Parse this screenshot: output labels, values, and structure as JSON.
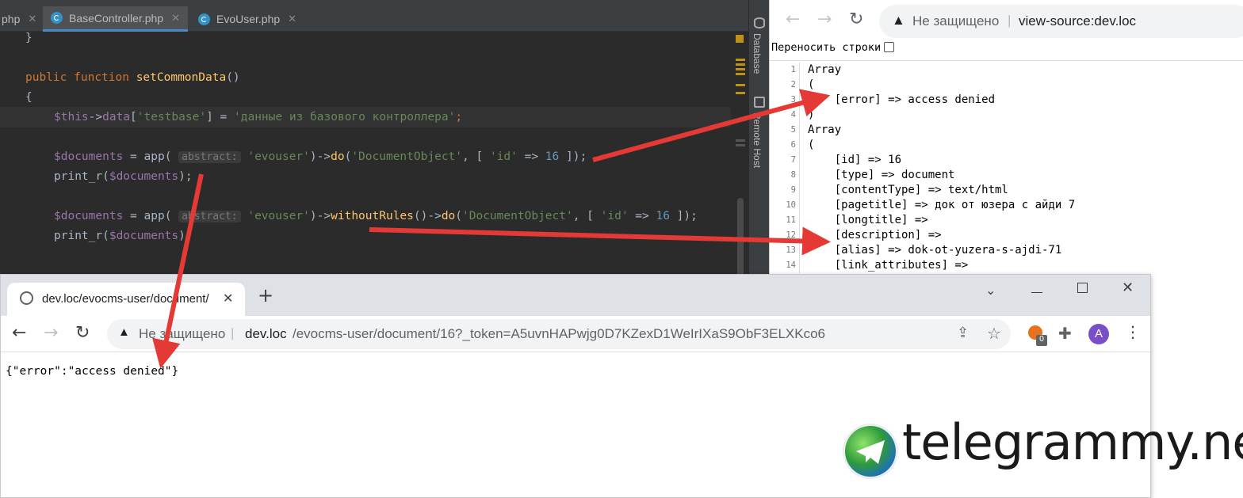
{
  "ide": {
    "tabs": [
      {
        "label": "php"
      },
      {
        "label": "BaseController.php"
      },
      {
        "label": "EvoUser.php"
      }
    ],
    "side_panels": [
      "Database",
      "Remote Host"
    ],
    "code": {
      "l1": "}",
      "public": "public",
      "function": "function",
      "method": "setCommonData",
      "paren": "()",
      "brace": "{",
      "this": "$this",
      "arrow": "->",
      "data": "data",
      "b1": "[",
      "testbase": "'testbase'",
      "b2": "] = ",
      "str_ru": "'данные из базового контроллера'",
      "semi": ";",
      "docs": "$documents",
      "eq_app": " = app(",
      "hint": "abstract:",
      "evouser": "'evouser'",
      "close1": ")->",
      "do": "do",
      "do_open": "(",
      "docobj": "'DocumentObject'",
      "arr_open": ", [ ",
      "id": "'id'",
      "fat": " => ",
      "num": "16",
      "arr_close": " ]);",
      "print_r": "print_r(",
      "close_semi": ");",
      "withoutRules": "withoutRules",
      "wr_close": "()->"
    }
  },
  "source_browser": {
    "security": "Не защищено",
    "url": "view-source:dev.loc",
    "wrap_label": "Переносить строки",
    "line_numbers": [
      "1",
      "2",
      "3",
      "4",
      "5",
      "6",
      "7",
      "8",
      "9",
      "10",
      "11",
      "12",
      "13",
      "14"
    ],
    "lines": [
      "Array",
      "(",
      "    [error] => access denied",
      ")",
      "Array",
      "(",
      "    [id] => 16",
      "    [type] => document",
      "    [contentType] => text/html",
      "    [pagetitle] => док от юзера с айди 7",
      "    [longtitle] =>",
      "    [description] =>",
      "    [alias] => dok-ot-yuzera-s-ajdi-71",
      "    [link_attributes] =>"
    ]
  },
  "browser": {
    "tab_title": "dev.loc/evocms-user/document/",
    "security": "Не защищено",
    "url_host": "dev.loc",
    "url_path": "/evocms-user/document/16?_token=A5uvnHAPwjg0D7KZexD1WeIrIXaS9ObF3ELXKco6",
    "profile_initial": "A",
    "ext_badge": "0",
    "response": "{\"error\":\"access denied\"}"
  },
  "watermark": {
    "text": "telegrammy.net"
  },
  "colors": {
    "arrow": "#e53935",
    "ide_bg": "#2b2b2b",
    "keyword": "#cc7832",
    "string": "#6a8759"
  }
}
